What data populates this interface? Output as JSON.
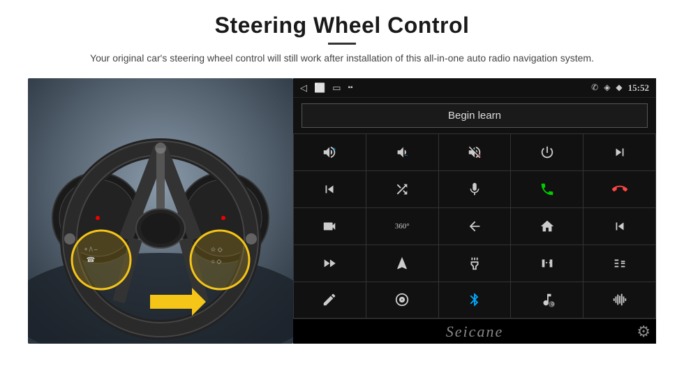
{
  "header": {
    "title": "Steering Wheel Control",
    "divider": true,
    "subtitle": "Your original car's steering wheel control will still work after installation of this all-in-one auto radio navigation system."
  },
  "status_bar": {
    "back_icon": "◁",
    "home_icon": "⬜",
    "recent_icon": "▭",
    "signal_icon": "▪▪",
    "phone_icon": "✆",
    "location_icon": "◈",
    "wifi_icon": "◆",
    "time": "15:52"
  },
  "begin_learn": {
    "label": "Begin learn"
  },
  "controls": [
    {
      "icon": "vol_up",
      "symbol": "🔊+",
      "row": 1,
      "col": 1
    },
    {
      "icon": "vol_down",
      "symbol": "🔉–",
      "row": 1,
      "col": 2
    },
    {
      "icon": "mute",
      "symbol": "🔇×",
      "row": 1,
      "col": 3
    },
    {
      "icon": "power",
      "symbol": "⏻",
      "row": 1,
      "col": 4
    },
    {
      "icon": "phone_prev",
      "symbol": "📞⏮",
      "row": 1,
      "col": 5
    },
    {
      "icon": "next",
      "symbol": "⏭",
      "row": 2,
      "col": 1
    },
    {
      "icon": "shuffle",
      "symbol": "⇄⏭",
      "row": 2,
      "col": 2
    },
    {
      "icon": "mic",
      "symbol": "🎤",
      "row": 2,
      "col": 3
    },
    {
      "icon": "phone",
      "symbol": "📞",
      "row": 2,
      "col": 4
    },
    {
      "icon": "hang_up",
      "symbol": "📵",
      "row": 2,
      "col": 5
    },
    {
      "icon": "camera",
      "symbol": "📷",
      "row": 3,
      "col": 1
    },
    {
      "icon": "360",
      "symbol": "360°",
      "row": 3,
      "col": 2
    },
    {
      "icon": "back",
      "symbol": "↩",
      "row": 3,
      "col": 3
    },
    {
      "icon": "home",
      "symbol": "⌂",
      "row": 3,
      "col": 4
    },
    {
      "icon": "skip_back",
      "symbol": "⏮⏮",
      "row": 3,
      "col": 5
    },
    {
      "icon": "fast_forward",
      "symbol": "⏭⏭",
      "row": 4,
      "col": 1
    },
    {
      "icon": "navigate",
      "symbol": "▲",
      "row": 4,
      "col": 2
    },
    {
      "icon": "eq",
      "symbol": "⇌",
      "row": 4,
      "col": 3
    },
    {
      "icon": "rec",
      "symbol": "📹",
      "row": 4,
      "col": 4
    },
    {
      "icon": "equalizer",
      "symbol": "🎚",
      "row": 4,
      "col": 5
    },
    {
      "icon": "pen",
      "symbol": "✏",
      "row": 5,
      "col": 1
    },
    {
      "icon": "circle_dot",
      "symbol": "🎯",
      "row": 5,
      "col": 2
    },
    {
      "icon": "bluetooth",
      "symbol": "⚡",
      "row": 5,
      "col": 3
    },
    {
      "icon": "music_settings",
      "symbol": "🎵⚙",
      "row": 5,
      "col": 4
    },
    {
      "icon": "bars",
      "symbol": "▐▌",
      "row": 5,
      "col": 5
    }
  ],
  "branding": {
    "seicane": "Seicane"
  },
  "icons": {
    "gear": "⚙"
  }
}
